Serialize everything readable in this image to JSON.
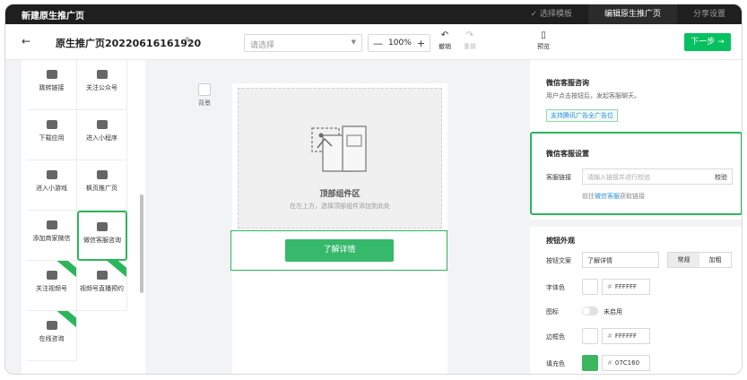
{
  "topbar": {
    "title": "新建原生推广页",
    "steps": [
      {
        "label": "✓ 选择模板",
        "active": false
      },
      {
        "label": "编辑原生推广页",
        "active": true
      },
      {
        "label": "分享设置",
        "active": false
      }
    ]
  },
  "toolbar": {
    "back_icon": "←",
    "page_name": "原生推广页20220616161920",
    "edit_icon": "✎",
    "select_placeholder": "请选择",
    "zoom": "100%",
    "zoom_minus": "—",
    "zoom_plus": "+",
    "undo_label": "撤销",
    "redo_label": "重做",
    "preview_label": "预览",
    "next_label": "下一步 →"
  },
  "components": [
    {
      "label": "跳转链接",
      "icon": "link-icon"
    },
    {
      "label": "关注公众号",
      "icon": "official-account-icon"
    },
    {
      "label": "下载应用",
      "icon": "download-icon"
    },
    {
      "label": "进入小程序",
      "icon": "mini-program-icon"
    },
    {
      "label": "进入小游戏",
      "icon": "mini-game-icon"
    },
    {
      "label": "枫页推广页",
      "icon": "grid-icon"
    },
    {
      "label": "添加商家微信",
      "icon": "wechat-icon"
    },
    {
      "label": "微信客服咨询",
      "icon": "customer-service-icon"
    },
    {
      "label": "关注视频号",
      "icon": "channels-icon"
    },
    {
      "label": "视频号直播预约",
      "icon": "live-icon"
    },
    {
      "label": "在线咨询",
      "icon": "chat-icon"
    }
  ],
  "canvas": {
    "background_label": "背景",
    "top_zone_title": "顶部组件区",
    "top_zone_hint": "在左上方，选择顶部组件添加到此处",
    "button_label": "了解详情"
  },
  "panel": {
    "intro_title": "微信客服咨询",
    "intro_desc": "用户点击按钮后，发起客服聊天。",
    "intro_tag": "支持腾讯广告全广告位",
    "cs_title": "微信客服设置",
    "cs_link_label": "客服链接",
    "cs_link_placeholder": "请输入链接并进行校验",
    "cs_verify": "校验",
    "cs_hint_prefix": "前往",
    "cs_hint_link": "微信客服",
    "cs_hint_suffix": "获取链接",
    "appearance_title": "按钮外观",
    "btn_text_label": "按钮文案",
    "btn_text_value": "了解详情",
    "weight_normal": "常规",
    "weight_bold": "加粗",
    "font_color_label": "字体色",
    "font_color_value": "FFFFFF",
    "icon_label": "图标",
    "icon_state": "未启用",
    "border_color_label": "边框色",
    "border_color_value": "FFFFFF",
    "fill_color_label": "填充色",
    "fill_color_value": "07C160"
  },
  "colors": {
    "accent": "#07c160",
    "fill_swatch": "#3cb65f"
  }
}
